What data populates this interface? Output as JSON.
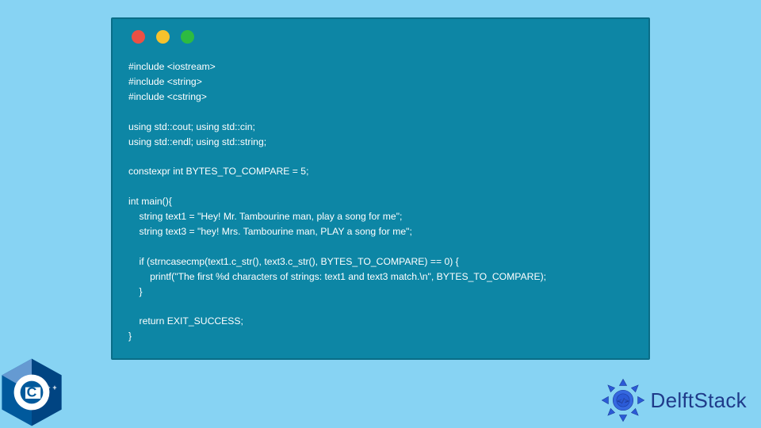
{
  "code": {
    "lines": [
      "#include <iostream>",
      "#include <string>",
      "#include <cstring>",
      "",
      "using std::cout; using std::cin;",
      "using std::endl; using std::string;",
      "",
      "constexpr int BYTES_TO_COMPARE = 5;",
      "",
      "int main(){",
      "    string text1 = \"Hey! Mr. Tambourine man, play a song for me\";",
      "    string text3 = \"hey! Mrs. Tambourine man, PLAY a song for me\";",
      "",
      "    if (strncasecmp(text1.c_str(), text3.c_str(), BYTES_TO_COMPARE) == 0) {",
      "        printf(\"The first %d characters of strings: text1 and text3 match.\\n\", BYTES_TO_COMPARE);",
      "    }",
      "",
      "    return EXIT_SUCCESS;",
      "}"
    ]
  },
  "cpp_logo_text": "C++",
  "brand": "DelftStack"
}
